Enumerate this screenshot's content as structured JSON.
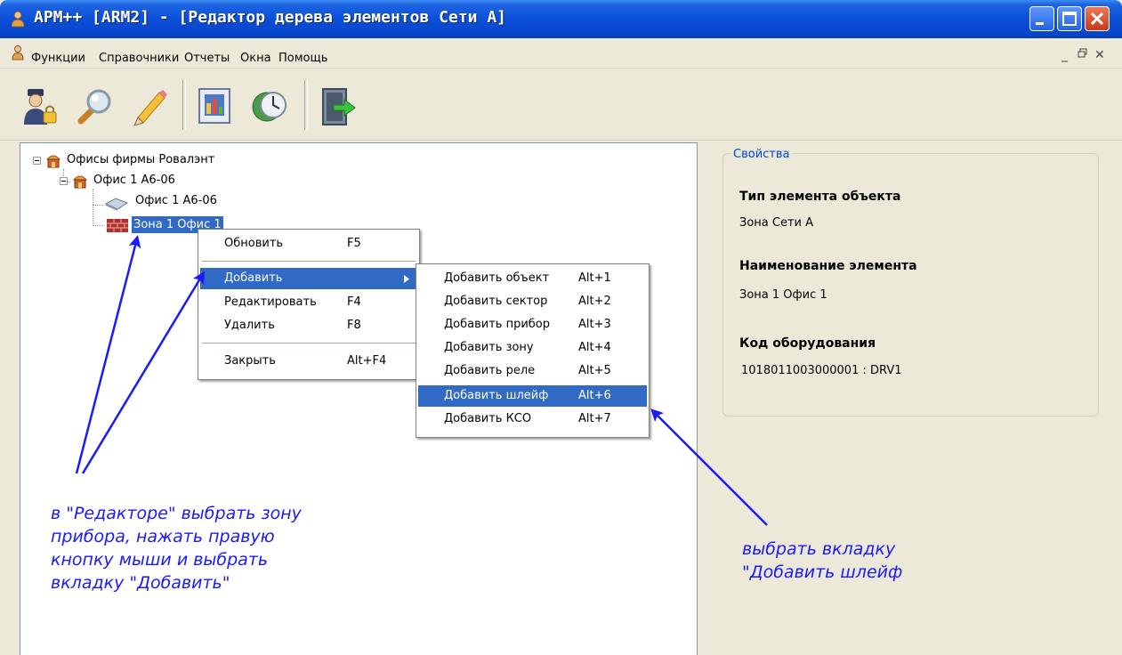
{
  "window": {
    "title": "АРМ++ [ARM2] - [Редактор дерева элементов Сети А]"
  },
  "menu": {
    "items": [
      "Функции",
      "Справочники",
      "Отчеты",
      "Окна",
      "Помощь"
    ]
  },
  "mdi_controls": {
    "minimize": "_",
    "restore": "▫",
    "close": "✕"
  },
  "toolbar": {
    "buttons": [
      "user-lock-icon",
      "search-icon",
      "pencil-icon",
      "report-icon",
      "clock-icon",
      "exit-door-icon"
    ]
  },
  "tree": {
    "nodes": [
      {
        "label": "Офисы фирмы Ровалэнт",
        "icon": "building-icon"
      },
      {
        "label": "Офис 1 А6-06",
        "icon": "building-icon"
      },
      {
        "label": "Офис 1 А6-06",
        "icon": "device-icon"
      },
      {
        "label": "Зона 1 Офис 1",
        "icon": "zone-wall-icon",
        "selected": true
      }
    ]
  },
  "context_menu": {
    "items": [
      {
        "label": "Обновить",
        "shortcut": "F5"
      },
      {
        "label": "Добавить",
        "shortcut": "",
        "highlighted": true,
        "submenu": true
      },
      {
        "label": "Редактировать",
        "shortcut": "F4"
      },
      {
        "label": "Удалить",
        "shortcut": "F8"
      },
      {
        "label": "Закрыть",
        "shortcut": "Alt+F4"
      }
    ]
  },
  "submenu": {
    "items": [
      {
        "label": "Добавить объект",
        "shortcut": "Alt+1"
      },
      {
        "label": "Добавить сектор",
        "shortcut": "Alt+2"
      },
      {
        "label": "Добавить прибор",
        "shortcut": "Alt+3"
      },
      {
        "label": "Добавить зону",
        "shortcut": "Alt+4"
      },
      {
        "label": "Добавить реле",
        "shortcut": "Alt+5"
      },
      {
        "label": "Добавить шлейф",
        "shortcut": "Alt+6",
        "highlighted": true
      },
      {
        "label": "Добавить КСО",
        "shortcut": "Alt+7"
      }
    ]
  },
  "properties": {
    "legend": "Свойства",
    "type_label": "Тип элемента объекта",
    "type_value": "Зона Сети А",
    "name_label": "Наименование элемента",
    "name_value": "Зона 1 Офис 1",
    "code_label": "Код оборудования",
    "code_value": "1018011003000001 : DRV1"
  },
  "annotations": {
    "left": [
      "в \"Редакторе\" выбрать зону",
      "прибора, нажать правую",
      "кнопку мыши и выбрать",
      "вкладку \"Добавить\""
    ],
    "right": [
      "выбрать вкладку",
      "\"Добавить шлейф"
    ]
  },
  "colors": {
    "titlebar": "#0a4fd8",
    "selection": "#316ac5",
    "annotation": "#1a1aff",
    "legend": "#0046d5"
  }
}
